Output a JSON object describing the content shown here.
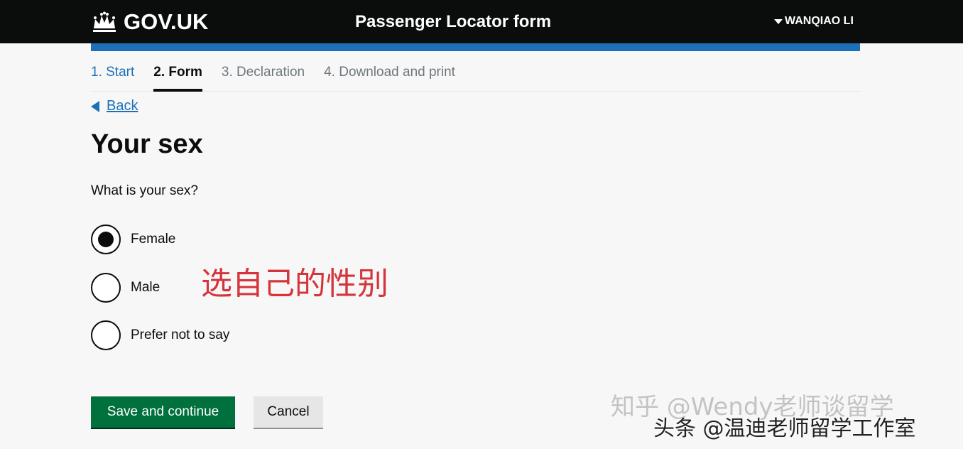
{
  "header": {
    "logo_text": "GOV.UK",
    "service_name": "Passenger Locator form",
    "account_name": "WANQIAO LI"
  },
  "steps": [
    {
      "label": "1. Start",
      "state": "done"
    },
    {
      "label": "2. Form",
      "state": "current"
    },
    {
      "label": "3. Declaration",
      "state": "todo"
    },
    {
      "label": "4. Download and print",
      "state": "todo"
    }
  ],
  "back_label": "Back",
  "page_title": "Your sex",
  "question": "What is your sex?",
  "options": [
    {
      "label": "Female",
      "checked": true
    },
    {
      "label": "Male",
      "checked": false
    },
    {
      "label": "Prefer not to say",
      "checked": false
    }
  ],
  "annotation": "选自己的性别",
  "buttons": {
    "save_label": "Save and continue",
    "cancel_label": "Cancel"
  },
  "watermarks": {
    "zhihu": "知乎 @Wendy老师谈留学",
    "toutiao": "头条 @温迪老师留学工作室"
  },
  "colors": {
    "header_bg": "#0b0c0c",
    "brand_blue": "#1d70b8",
    "primary_button": "#00703c",
    "annotation_red": "#d4353b"
  }
}
